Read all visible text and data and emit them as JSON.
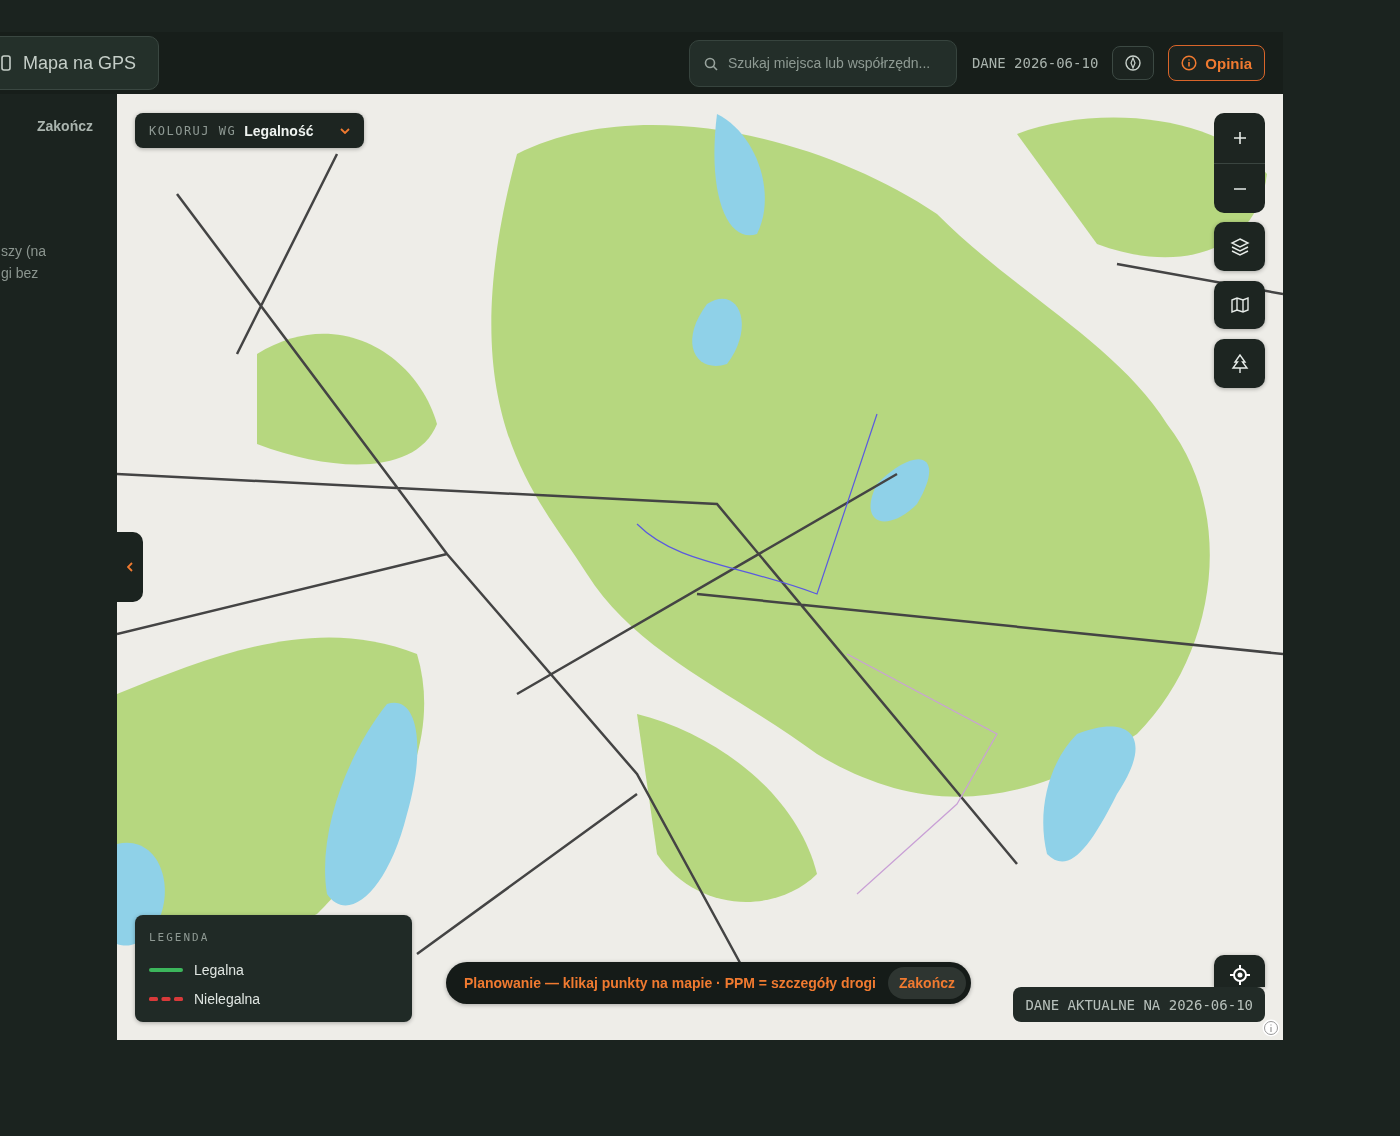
{
  "header": {
    "gps_button": "Mapa na GPS",
    "search": {
      "placeholder": "Szukaj miejsca lub współrzędn..."
    },
    "data_date": "DANE 2026-06-10",
    "feedback_button": "Opinia"
  },
  "side_panel": {
    "finish_link": "Zakończ",
    "text_lines": [
      "szy (na",
      "gi bez"
    ]
  },
  "color_by": {
    "label": "KOLORUJ WG",
    "value": "Legalność"
  },
  "legend": {
    "title": "LEGENDA",
    "items": [
      {
        "label": "Legalna",
        "kind": "solid",
        "color": "#3cb65c"
      },
      {
        "label": "Nielegalna",
        "kind": "dashed",
        "color": "#d83a3a"
      }
    ]
  },
  "planning_bar": {
    "text": "Planowanie — klikaj punkty na mapie · PPM = szczegóły drogi",
    "finish_button": "Zakończ"
  },
  "data_status": "DANE AKTUALNE NA 2026-06-10"
}
